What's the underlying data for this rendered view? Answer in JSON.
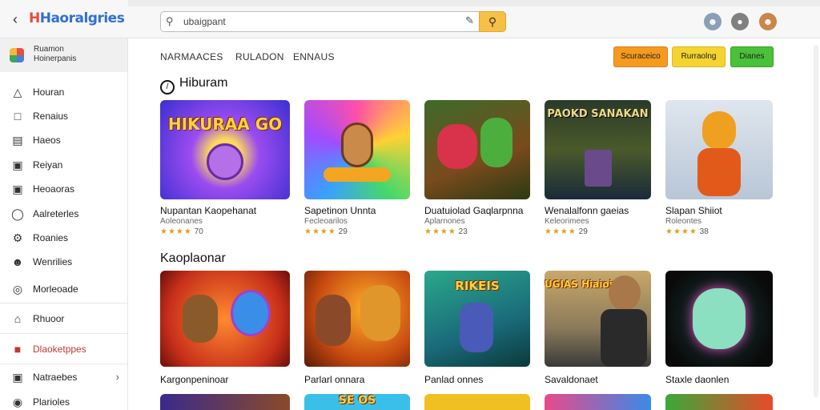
{
  "app": {
    "logo": "Haoralgries",
    "search_text": "ubaigpant"
  },
  "sidebar": {
    "profile": {
      "line1": "Ruamon",
      "line2": "Hoinerpanis"
    },
    "items": [
      {
        "label": "Houran",
        "icon": "warning-triangle-icon"
      },
      {
        "label": "Renaius",
        "icon": "calendar-icon"
      },
      {
        "label": "Haeos",
        "icon": "list-icon"
      },
      {
        "label": "Reiyan",
        "icon": "briefcase-icon"
      },
      {
        "label": "Heoaoras",
        "icon": "camera-icon"
      },
      {
        "label": "Aalreterles",
        "icon": "tag-icon"
      },
      {
        "label": "Roanies",
        "icon": "gear-icon"
      },
      {
        "label": "Wenrilies",
        "icon": "user-icon"
      },
      {
        "label": "Morleoade",
        "icon": "globe-icon"
      },
      {
        "label": "Rhuoor",
        "icon": "home-icon"
      },
      {
        "label": "Dlaoketppes",
        "icon": "bookmark-icon"
      },
      {
        "label": "Natraebes",
        "icon": "store-icon"
      },
      {
        "label": "Plarioles",
        "icon": "location-icon"
      }
    ]
  },
  "tabs": [
    "NARMAACES",
    "RULADON",
    "ENNAUS"
  ],
  "filters": [
    {
      "label": "Scuraceico",
      "color": "#f49a1e"
    },
    {
      "label": "Rurraolng",
      "color": "#f5d431"
    },
    {
      "label": "Dianes",
      "color": "#49c23a"
    }
  ],
  "sections": [
    {
      "title": "Hiburam",
      "cards": [
        {
          "title": "Nupantan Kaopehanat",
          "sub": "Aoleonanes",
          "rating": "70",
          "thumb_text": "HIKURAA GO"
        },
        {
          "title": "Sapetinon Unnta",
          "sub": "Fecleoarilos",
          "rating": "29",
          "thumb_text": ""
        },
        {
          "title": "Duatuiolad Gaqlarpnna",
          "sub": "Aplarnones",
          "rating": "23",
          "thumb_text": ""
        },
        {
          "title": "Wenalalfonn gaeias",
          "sub": "Keleorimees",
          "rating": "29",
          "thumb_text": "PAOKD SANAKAN"
        },
        {
          "title": "Slapan Shiiot",
          "sub": "Roleontes",
          "rating": "38",
          "thumb_text": ""
        }
      ]
    },
    {
      "title": "Kaoplaonar",
      "cards": [
        {
          "title": "Kargonpeninoar",
          "thumb_text": ""
        },
        {
          "title": "Parlarl onnara",
          "thumb_text": ""
        },
        {
          "title": "Panlad onnes",
          "thumb_text": "RIKEIS"
        },
        {
          "title": "Savaldonaet",
          "thumb_text": "MUGIAS Hiaioie"
        },
        {
          "title": "Staxle daonlen",
          "thumb_text": ""
        }
      ]
    }
  ],
  "third_row_text": "SE OS"
}
